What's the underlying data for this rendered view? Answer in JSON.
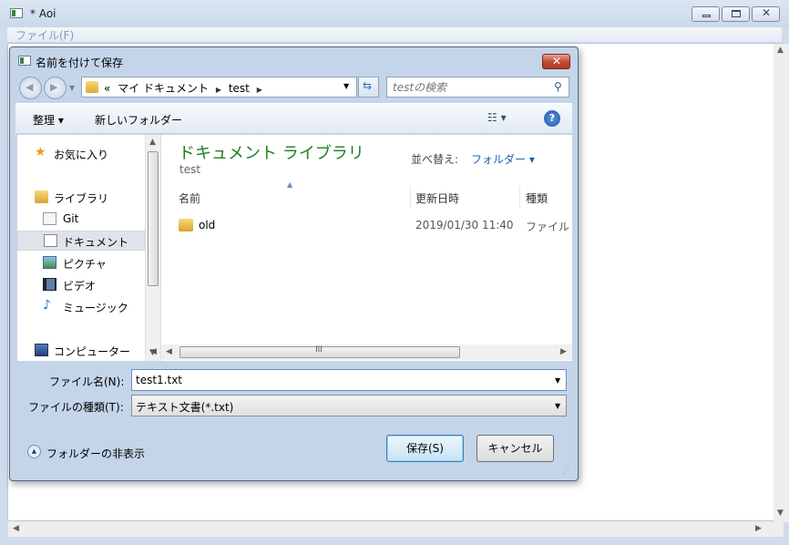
{
  "main_window": {
    "title": "* Aoi",
    "menu_file": "ファイル(F)"
  },
  "dialog": {
    "title": "名前を付けて保存",
    "address": {
      "crumb_prefix": "«",
      "crumb_1": "マイ ドキュメント",
      "crumb_2": "test"
    },
    "search_placeholder": "testの検索",
    "toolbar": {
      "organize": "整理 ▾",
      "new_folder": "新しいフォルダー"
    },
    "nav": {
      "favorites": "お気に入り",
      "libraries": "ライブラリ",
      "git": "Git",
      "documents": "ドキュメント",
      "pictures": "ピクチャ",
      "videos": "ビデオ",
      "music": "ミュージック",
      "computer": "コンピューター"
    },
    "content": {
      "library_title": "ドキュメント ライブラリ",
      "library_subtitle": "test",
      "sort_label": "並べ替え:",
      "sort_value": "フォルダー ▾",
      "columns": {
        "name": "名前",
        "date": "更新日時",
        "type": "種類"
      },
      "files": [
        {
          "name": "old",
          "date": "2019/01/30 11:40",
          "type": "ファイル"
        }
      ],
      "scroll_label": "III"
    },
    "filename_label": "ファイル名(N):",
    "filename_value": "test1.txt",
    "filetype_label": "ファイルの種類(T):",
    "filetype_value": "テキスト文書(*.txt)",
    "hide_folders": "フォルダーの非表示",
    "save_button": "保存(S)",
    "cancel_button": "キャンセル"
  },
  "colors": {
    "library_title": "#1e7f1e",
    "link_blue": "#1f5fb0",
    "dialog_frame": "#c4d5ea",
    "close_red": "#c44a32"
  }
}
